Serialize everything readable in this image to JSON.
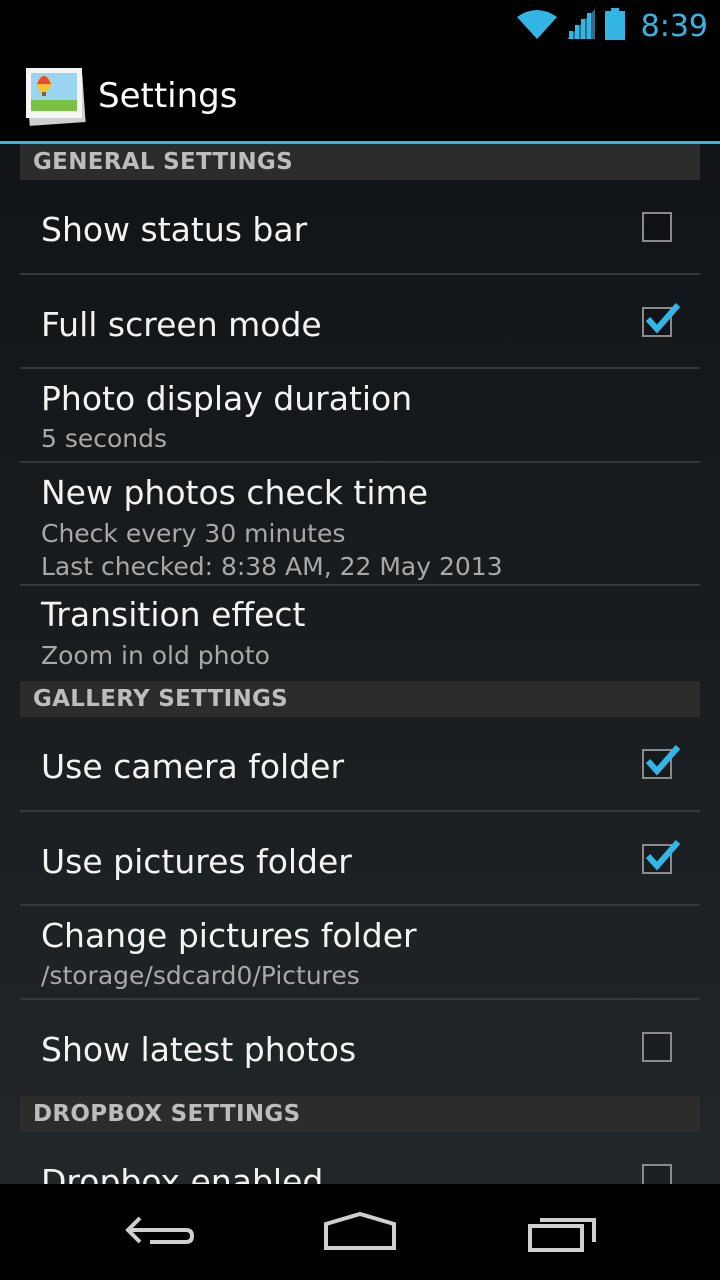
{
  "status_bar": {
    "time": "8:39",
    "icons": [
      "wifi-icon",
      "signal-icon",
      "battery-icon"
    ]
  },
  "action_bar": {
    "title": "Settings",
    "icon": "gallery-app-icon"
  },
  "colors": {
    "accent": "#33b5e5",
    "background": "#000000",
    "section_bg": "#2c2c2c"
  },
  "sections": [
    {
      "header": "GENERAL SETTINGS"
    },
    {
      "header": "GALLERY SETTINGS"
    },
    {
      "header": "DROPBOX SETTINGS"
    }
  ],
  "prefs": {
    "show_status_bar": {
      "title": "Show status bar",
      "checked": false
    },
    "full_screen_mode": {
      "title": "Full screen mode",
      "checked": true
    },
    "photo_display_duration": {
      "title": "Photo display duration",
      "summary": "5 seconds"
    },
    "new_photos_check_time": {
      "title": "New photos check time",
      "summary": "Check every 30 minutes",
      "summary2": "Last checked: 8:38 AM, 22 May 2013"
    },
    "transition_effect": {
      "title": "Transition effect",
      "summary": "Zoom in old photo"
    },
    "use_camera_folder": {
      "title": "Use camera folder",
      "checked": true
    },
    "use_pictures_folder": {
      "title": "Use pictures folder",
      "checked": true
    },
    "change_pictures_folder": {
      "title": "Change pictures folder",
      "summary": "/storage/sdcard0/Pictures"
    },
    "show_latest_photos": {
      "title": "Show latest photos",
      "checked": false
    },
    "dropbox_enabled": {
      "title": "Dropbox enabled",
      "checked": false
    }
  },
  "nav_bar": {
    "buttons": [
      "back-icon",
      "home-icon",
      "recents-icon"
    ]
  }
}
